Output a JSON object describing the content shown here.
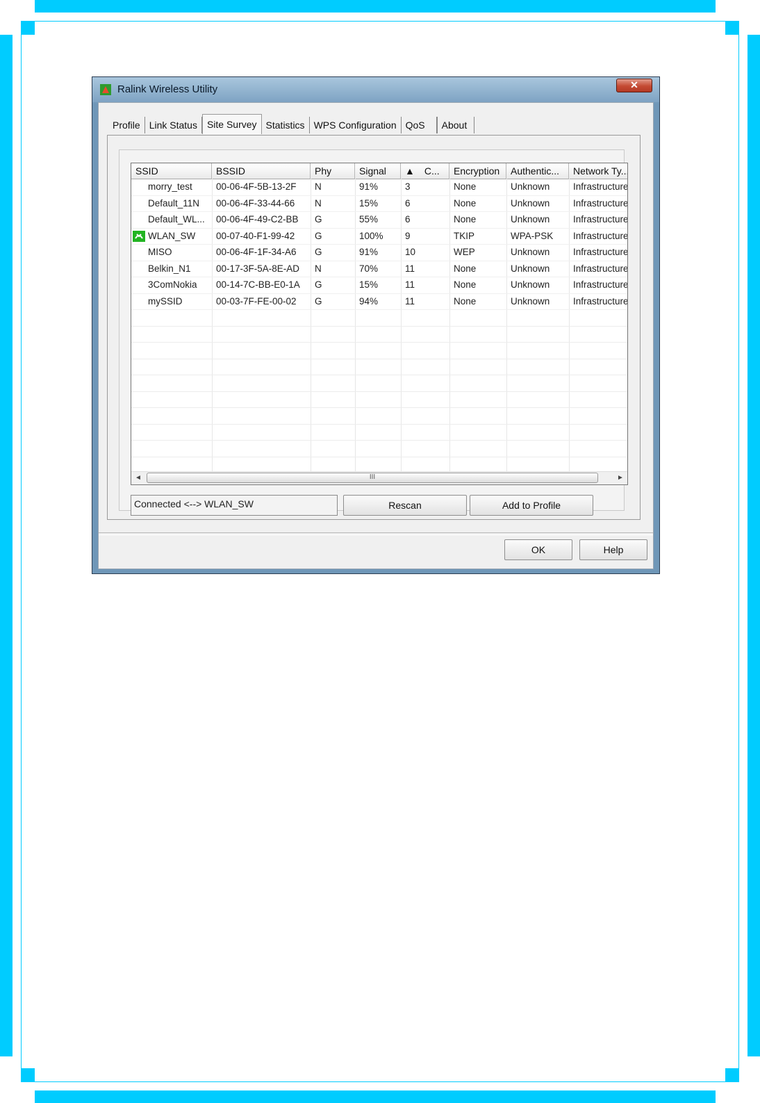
{
  "window": {
    "title": "Ralink Wireless Utility",
    "close_label": "✕"
  },
  "tabs": [
    {
      "label": "Profile",
      "active": false
    },
    {
      "label": "Link Status",
      "active": false
    },
    {
      "label": "Site Survey",
      "active": true
    },
    {
      "label": "Statistics",
      "active": false
    },
    {
      "label": "WPS Configuration",
      "active": false
    },
    {
      "label": "QoS",
      "active": false
    },
    {
      "label": "About",
      "active": false
    }
  ],
  "table": {
    "columns": [
      "SSID",
      "BSSID",
      "Phy",
      "Signal",
      "C...",
      "Encryption",
      "Authentic...",
      "Network Ty..."
    ],
    "sort_indicator": "▲",
    "rows": [
      {
        "ssid": "morry_test",
        "bssid": "00-06-4F-5B-13-2F",
        "phy": "N",
        "signal": "91%",
        "channel": "3",
        "encryption": "None",
        "auth": "Unknown",
        "network": "Infrastructure"
      },
      {
        "ssid": "Default_11N",
        "bssid": "00-06-4F-33-44-66",
        "phy": "N",
        "signal": "15%",
        "channel": "6",
        "encryption": "None",
        "auth": "Unknown",
        "network": "Infrastructure"
      },
      {
        "ssid": "Default_WL...",
        "bssid": "00-06-4F-49-C2-BB",
        "phy": "G",
        "signal": "55%",
        "channel": "6",
        "encryption": "None",
        "auth": "Unknown",
        "network": "Infrastructure"
      },
      {
        "ssid": "WLAN_SW",
        "bssid": "00-07-40-F1-99-42",
        "phy": "G",
        "signal": "100%",
        "channel": "9",
        "encryption": "TKIP",
        "auth": "WPA-PSK",
        "network": "Infrastructure",
        "connected": true
      },
      {
        "ssid": "MISO",
        "bssid": "00-06-4F-1F-34-A6",
        "phy": "G",
        "signal": "91%",
        "channel": "10",
        "encryption": "WEP",
        "auth": "Unknown",
        "network": "Infrastructure"
      },
      {
        "ssid": "Belkin_N1",
        "bssid": "00-17-3F-5A-8E-AD",
        "phy": "N",
        "signal": "70%",
        "channel": "11",
        "encryption": "None",
        "auth": "Unknown",
        "network": "Infrastructure"
      },
      {
        "ssid": "3ComNokia",
        "bssid": "00-14-7C-BB-E0-1A",
        "phy": "G",
        "signal": "15%",
        "channel": "11",
        "encryption": "None",
        "auth": "Unknown",
        "network": "Infrastructure"
      },
      {
        "ssid": "mySSID",
        "bssid": "00-03-7F-FE-00-02",
        "phy": "G",
        "signal": "94%",
        "channel": "11",
        "encryption": "None",
        "auth": "Unknown",
        "network": "Infrastructure"
      }
    ],
    "scroll_thumb_grip": "III",
    "scroll_left": "◄",
    "scroll_right": "►"
  },
  "status": {
    "text": "Connected <--> WLAN_SW"
  },
  "buttons": {
    "rescan": "Rescan",
    "add_to_profile": "Add to Profile",
    "ok": "OK",
    "help": "Help"
  },
  "colors": {
    "page_border": "#00ccff",
    "connected_icon": "#22b422"
  }
}
